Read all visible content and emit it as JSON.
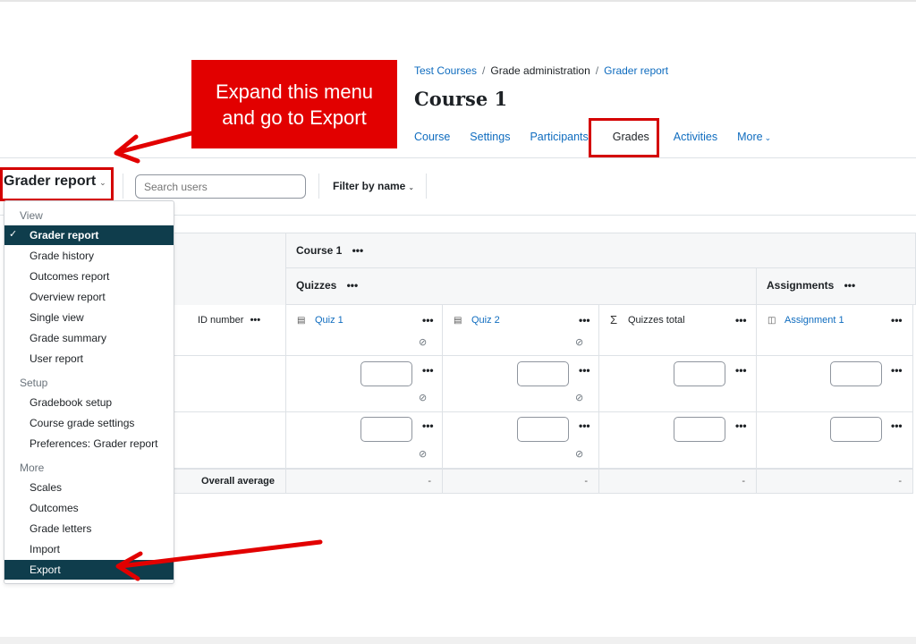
{
  "breadcrumb": [
    "Test Courses",
    "Grade administration",
    "Grader report"
  ],
  "page_title": "Course 1",
  "nav": {
    "items": [
      "Course",
      "Settings",
      "Participants",
      "Grades",
      "Activities",
      "More"
    ],
    "active": "Grades"
  },
  "callout": {
    "line1": "Expand this menu",
    "line2": "and go to Export"
  },
  "toolbar": {
    "report_selector": "Grader report",
    "search_placeholder": "Search users",
    "filter_label": "Filter by name"
  },
  "menu": {
    "sections": [
      {
        "heading": "View",
        "items": [
          "Grader report",
          "Grade history",
          "Outcomes report",
          "Overview report",
          "Single view",
          "Grade summary",
          "User report"
        ]
      },
      {
        "heading": "Setup",
        "items": [
          "Gradebook setup",
          "Course grade settings",
          "Preferences: Grader report"
        ]
      },
      {
        "heading": "More",
        "items": [
          "Scales",
          "Outcomes",
          "Grade letters",
          "Import",
          "Export"
        ]
      }
    ],
    "selected": "Grader report",
    "highlighted": "Export"
  },
  "grid": {
    "course_category": "Course 1",
    "categories": [
      "Quizzes",
      "Assignments"
    ],
    "id_column": "ID number",
    "items": [
      {
        "label": "Quiz 1",
        "icon": "quiz-icon"
      },
      {
        "label": "Quiz 2",
        "icon": "quiz-icon"
      },
      {
        "label": "Quizzes total",
        "icon": "sigma-icon"
      },
      {
        "label": "Assignment 1",
        "icon": "assignment-icon"
      }
    ],
    "actions_glyph": "•••",
    "overall_average_label": "Overall average",
    "overall_average_values": [
      "-",
      "-",
      "-",
      "-"
    ]
  },
  "colors": {
    "annotation_red": "#e20000",
    "link_blue": "#0f6cbf",
    "menu_active": "#0f3d4c"
  }
}
